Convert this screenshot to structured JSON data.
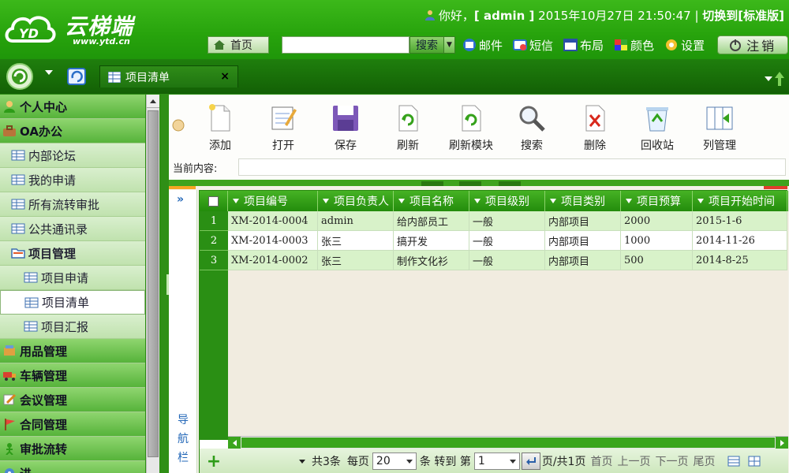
{
  "brand": {
    "name": "云梯端",
    "url": "www.ytd.cn"
  },
  "userbar": {
    "greeting": "你好，",
    "username": "[ admin ]",
    "datetime": "2015年10月27日 21:50:47",
    "separator": "|",
    "switch": "切换到[标准版]"
  },
  "nav": {
    "home": "首页",
    "search_placeholder": "",
    "search_btn": "搜索",
    "menu": [
      "邮件",
      "短信",
      "布局",
      "颜色",
      "设置"
    ],
    "logout": "注销"
  },
  "tab": {
    "label": "项目清单",
    "close": "×"
  },
  "sidebar": [
    {
      "label": "个人中心",
      "level": "group",
      "icon": "user-icon"
    },
    {
      "label": "OA办公",
      "level": "group",
      "icon": "briefcase-icon"
    },
    {
      "label": "内部论坛",
      "level": "sub",
      "icon": "grid-icon"
    },
    {
      "label": "我的申请",
      "level": "sub",
      "icon": "grid-icon"
    },
    {
      "label": "所有流转审批",
      "level": "sub",
      "icon": "grid-icon"
    },
    {
      "label": "公共通讯录",
      "level": "sub",
      "icon": "grid-icon"
    },
    {
      "label": "项目管理",
      "level": "sub-folder",
      "icon": "folder-icon"
    },
    {
      "label": "项目申请",
      "level": "subsub",
      "icon": "grid-icon"
    },
    {
      "label": "项目清单",
      "level": "subsub-active",
      "icon": "grid-icon"
    },
    {
      "label": "项目汇报",
      "level": "subsub",
      "icon": "grid-icon"
    },
    {
      "label": "用品管理",
      "level": "group",
      "icon": "box-icon"
    },
    {
      "label": "车辆管理",
      "level": "group",
      "icon": "truck-icon"
    },
    {
      "label": "会议管理",
      "level": "group",
      "icon": "pen-icon"
    },
    {
      "label": "合同管理",
      "level": "group",
      "icon": "flag-icon"
    },
    {
      "label": "审批流转",
      "level": "group",
      "icon": "person-icon"
    },
    {
      "label": "进",
      "level": "group",
      "icon": "gear-icon"
    }
  ],
  "toolbar": {
    "tools": [
      "添加",
      "打开",
      "保存",
      "刷新",
      "刷新模块",
      "搜索",
      "删除",
      "回收站",
      "列管理"
    ],
    "current_label": "当前内容:",
    "current_value": ""
  },
  "navcol": {
    "chevron": "»",
    "label": "导航栏"
  },
  "grid": {
    "columns": [
      "项目编号",
      "项目负责人",
      "项目名称",
      "项目级别",
      "项目类别",
      "项目预算",
      "项目开始时间"
    ],
    "rows": [
      [
        "1",
        "XM-2014-0004",
        "admin",
        "给内部员工",
        "一般",
        "内部项目",
        "2000",
        "2015-1-6"
      ],
      [
        "2",
        "XM-2014-0003",
        "张三",
        "搞开发",
        "一般",
        "内部项目",
        "1000",
        "2014-11-26"
      ],
      [
        "3",
        "XM-2014-0002",
        "张三",
        "制作文化衫",
        "一般",
        "内部项目",
        "500",
        "2014-8-25"
      ]
    ]
  },
  "pager": {
    "total": "共3条",
    "per_page_label": "每页",
    "per_page": "20",
    "goto_label": "条 转到 第",
    "page": "1",
    "page_info": "页/共1页",
    "first": "首页",
    "prev": "上一页",
    "next": "下一页",
    "last": "尾页"
  },
  "colors": {
    "brand_green": "#2f9f14",
    "dark_green": "#136005",
    "row_alt": "#d8f2c9"
  }
}
